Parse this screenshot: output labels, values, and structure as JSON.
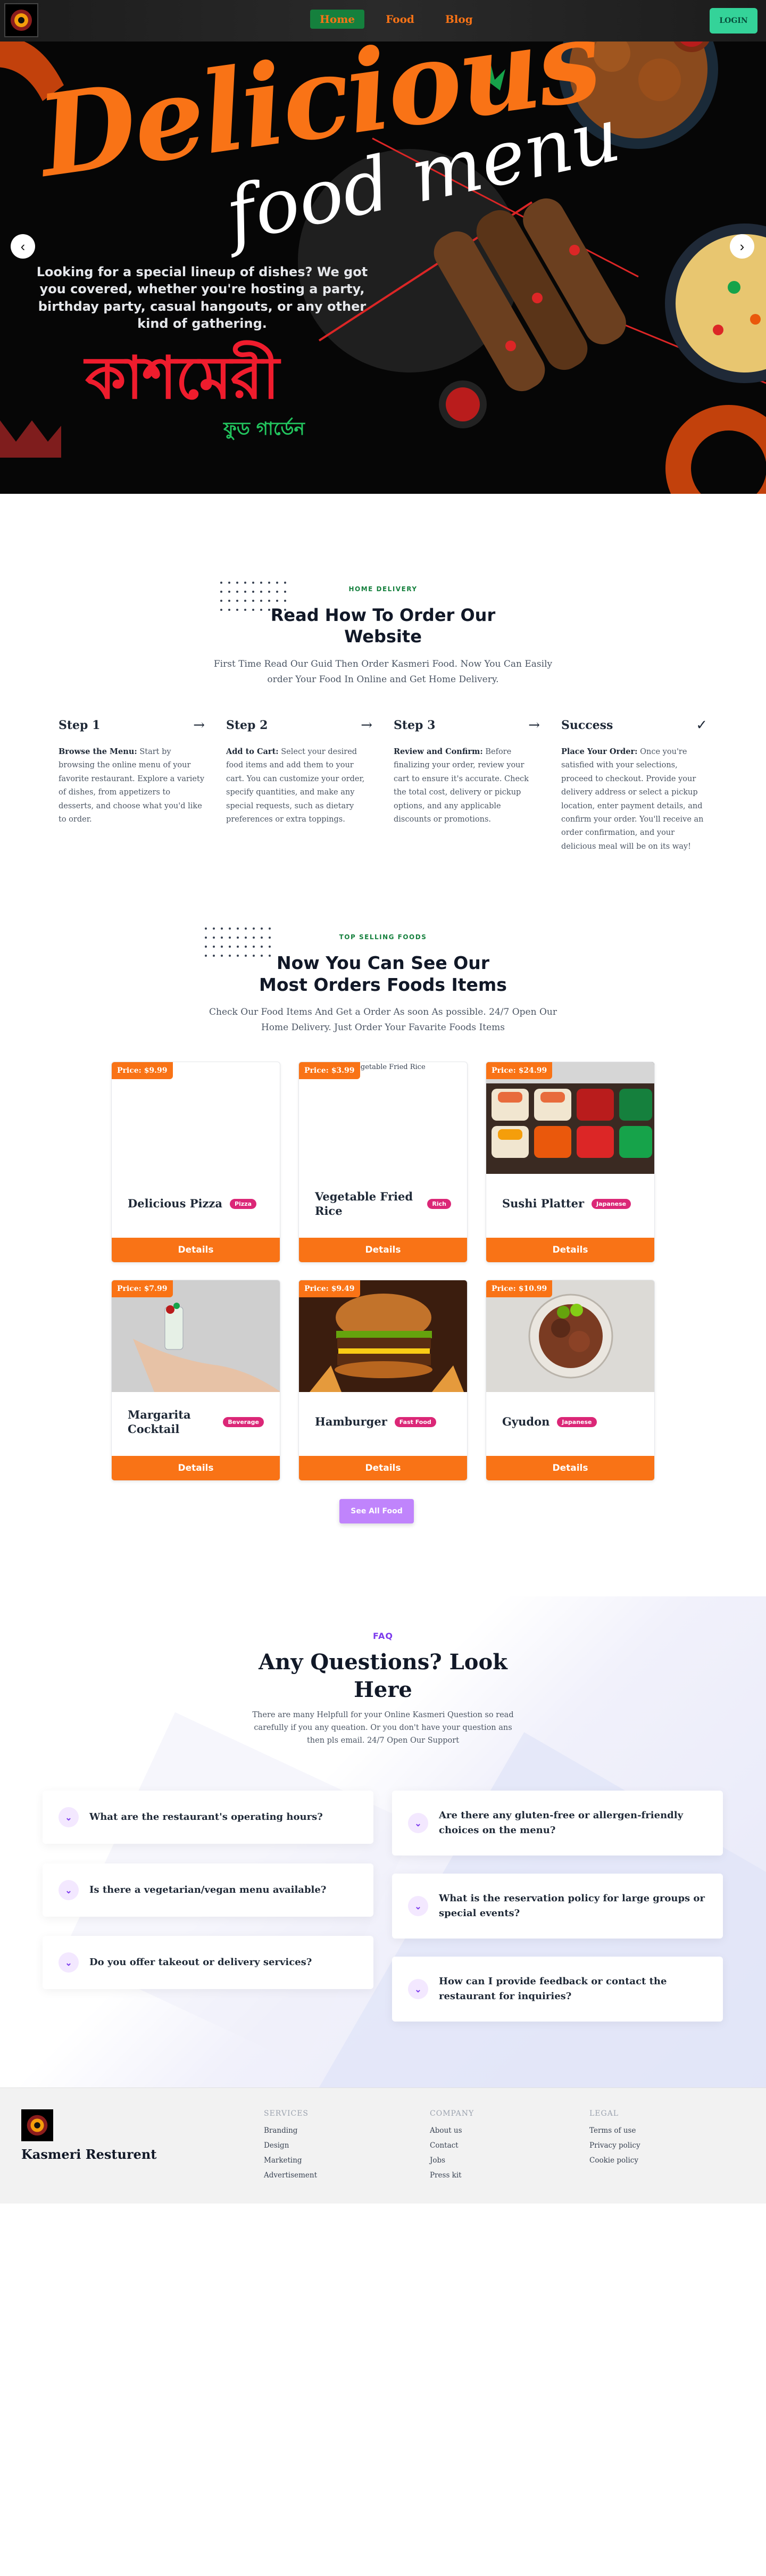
{
  "nav": {
    "links": [
      "Home",
      "Food",
      "Blog"
    ],
    "login": "LOGIN"
  },
  "hero": {
    "title": "Delicious",
    "subtitle": "food menu",
    "text": "Looking for a special lineup of dishes? We got you covered, whether you're hosting a party, birthday party, casual hangouts, or any other kind of gathering.",
    "brand": "কাশমেরী",
    "brand_sub": "ফুড গার্ডেন",
    "prev": "‹",
    "next": "›"
  },
  "howto": {
    "eyebrow": "HOME DELIVERY",
    "title": "Read How To Order Our Website",
    "desc": "First Time Read Our Guid Then Order Kasmeri Food. Now You Can Easily order Your Food In Online and Get Home Delivery.",
    "steps": [
      {
        "title": "Step 1",
        "icon": "→",
        "lead": "Browse the Menu:",
        "body": " Start by browsing the online menu of your favorite restaurant. Explore a variety of dishes, from appetizers to desserts, and choose what you'd like to order."
      },
      {
        "title": "Step 2",
        "icon": "→",
        "lead": "Add to Cart:",
        "body": " Select your desired food items and add them to your cart. You can customize your order, specify quantities, and make any special requests, such as dietary preferences or extra toppings."
      },
      {
        "title": "Step 3",
        "icon": "→",
        "lead": "Review and Confirm:",
        "body": " Before finalizing your order, review your cart to ensure it's accurate. Check the total cost, delivery or pickup options, and any applicable discounts or promotions."
      },
      {
        "title": "Success",
        "icon": "✓",
        "lead": "Place Your Order:",
        "body": " Once you're satisfied with your selections, proceed to checkout. Provide your delivery address or select a pickup location, enter payment details, and confirm your order. You'll receive an order confirmation, and your delicious meal will be on its way!"
      }
    ]
  },
  "foods": {
    "eyebrow": "TOP SELLING FOODS",
    "title": "Now You Can See Our Most Orders Foods Items",
    "desc": "Check Our Food Items And Get a Order As soon As possible. 24/7 Open Our Home Delivery. Just Order Your Favarite Foods Items",
    "details_label": "Details",
    "see_all": "See All Food",
    "items": [
      {
        "price": "Price: $9.99",
        "name": "Delicious Pizza",
        "tag": "Pizza",
        "image": "broken",
        "alt": "Delicious Pizza"
      },
      {
        "price": "Price: $3.99",
        "name": "Vegetable Fried Rice",
        "tag": "Rich",
        "image": "broken",
        "alt": "Vegetable Fried Rice"
      },
      {
        "price": "Price: $24.99",
        "name": "Sushi Platter",
        "tag": "Japanese",
        "image": "sushi"
      },
      {
        "price": "Price: $7.99",
        "name": "Margarita Cocktail",
        "tag": "Beverage",
        "image": "cocktail"
      },
      {
        "price": "Price: $9.49",
        "name": "Hamburger",
        "tag": "Fast Food",
        "image": "burger"
      },
      {
        "price": "Price: $10.99",
        "name": "Gyudon",
        "tag": "Japanese",
        "image": "gyudon"
      }
    ]
  },
  "faq": {
    "eyebrow": "FAQ",
    "title": "Any Questions? Look Here",
    "desc": "There are many Helpfull for your Online Kasmeri Question so read carefully if you any queation. Or you don't have your question ans then pls email. 24/7 Open Our Support",
    "questions": [
      "What are the restaurant's operating hours?",
      "Is there a vegetarian/vegan menu available?",
      "Do you offer takeout or delivery services?",
      "Are there any gluten-free or allergen-friendly choices on the menu?",
      "What is the reservation policy for large groups or special events?",
      "How can I provide feedback or contact the restaurant for inquiries?"
    ]
  },
  "footer": {
    "brand": "Kasmeri Resturent",
    "columns": [
      {
        "title": "SERVICES",
        "links": [
          "Branding",
          "Design",
          "Marketing",
          "Advertisement"
        ]
      },
      {
        "title": "COMPANY",
        "links": [
          "About us",
          "Contact",
          "Jobs",
          "Press kit"
        ]
      },
      {
        "title": "LEGAL",
        "links": [
          "Terms of use",
          "Privacy policy",
          "Cookie policy"
        ]
      }
    ]
  },
  "colors": {
    "accent": "#f97316",
    "nav_active": "#15803d",
    "login": "#34d399",
    "tag": "#db2777",
    "see_all": "#c084fc",
    "faq_accent": "#7c3aed"
  }
}
